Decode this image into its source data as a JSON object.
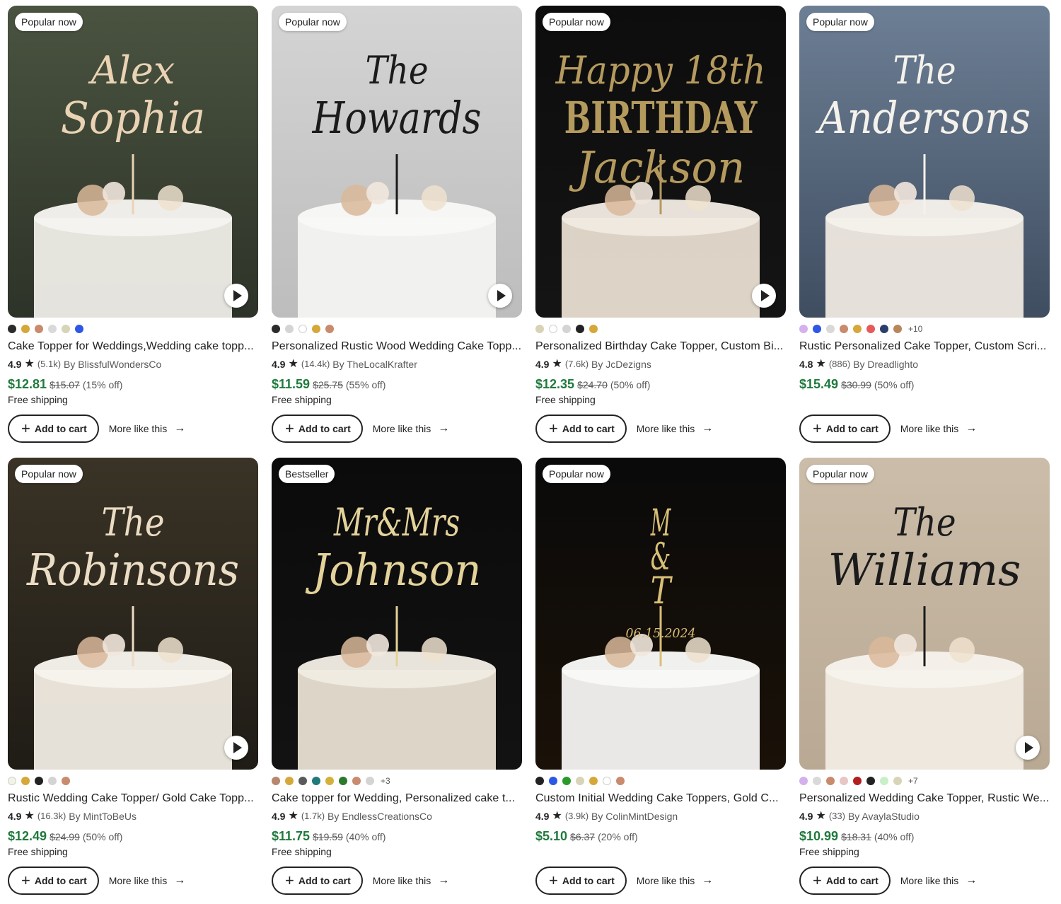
{
  "products": [
    {
      "badge": "Popular now",
      "has_video": true,
      "title": "Cake Topper for Weddings,Wedding cake topp...",
      "rating": "4.9",
      "reviews": "(5.1k)",
      "shop": "By BlissfulWondersCo",
      "price": "$12.81",
      "original_price": "$15.07",
      "discount": "(15% off)",
      "shipping": "Free shipping",
      "swatches": [
        "#2b2b2b",
        "#d6a83a",
        "#c98a6d",
        "#d9d9d9",
        "#d8d4b8",
        "#2e57e6"
      ],
      "more_swatches": "",
      "image": {
        "name": "cake-topper-alex-sophia-image",
        "bg": [
          "#4a5340",
          "#2d3328"
        ],
        "script": [
          "Alex",
          "Sophia"
        ],
        "script_color": "#e9d3b4",
        "cake": "#efede7"
      }
    },
    {
      "badge": "Popular now",
      "has_video": true,
      "title": "Personalized Rustic Wood Wedding Cake Topp...",
      "rating": "4.9",
      "reviews": "(14.4k)",
      "shop": "By TheLocalKrafter",
      "price": "$11.59",
      "original_price": "$25.75",
      "discount": "(55% off)",
      "shipping": "Free shipping",
      "swatches": [
        "#2b2b2b",
        "#d4d4d4",
        "#ffffff",
        "#d6a83a",
        "#c98a6d"
      ],
      "more_swatches": "",
      "image": {
        "name": "cake-topper-howards-image",
        "bg": [
          "#d4d4d4",
          "#bdbdbd"
        ],
        "script": [
          "The",
          "Howards"
        ],
        "script_color": "#1b1b1b",
        "cake": "#f3f3f1"
      }
    },
    {
      "badge": "Popular now",
      "has_video": true,
      "title": "Personalized Birthday Cake Topper, Custom Bi...",
      "rating": "4.9",
      "reviews": "(7.6k)",
      "shop": "By JcDezigns",
      "price": "$12.35",
      "original_price": "$24.70",
      "discount": "(50% off)",
      "shipping": "Free shipping",
      "swatches": [
        "#d8d2b6",
        "#ffffff",
        "#d4d4d4",
        "#222222",
        "#d6a83a"
      ],
      "more_swatches": "",
      "image": {
        "name": "cake-topper-happy-18th-birthday-image",
        "bg": [
          "#0d0d0d",
          "#141414"
        ],
        "script": [
          "Happy 18th",
          "BIRTHDAY",
          "Jackson"
        ],
        "script_color": "#b59a5e",
        "cake": "#e8ddd0"
      }
    },
    {
      "badge": "Popular now",
      "has_video": false,
      "title": "Rustic Personalized Cake Topper, Custom Scri...",
      "rating": "4.8",
      "reviews": "(886)",
      "shop": "By Dreadlighto",
      "price": "$15.49",
      "original_price": "$30.99",
      "discount": "(50% off)",
      "shipping": "",
      "swatches": [
        "#d4b0ec",
        "#2e57e6",
        "#d9d9d9",
        "#c98a6d",
        "#d6a83a",
        "#e55a5a",
        "#2b3e6b",
        "#b8865a"
      ],
      "more_swatches": "+10",
      "image": {
        "name": "cake-topper-andersons-image",
        "bg": [
          "#6d7f95",
          "#3f4d60"
        ],
        "script": [
          "The",
          "Andersons"
        ],
        "script_color": "#f5f2ec",
        "cake": "#eee8df"
      }
    },
    {
      "badge": "Popular now",
      "has_video": true,
      "title": "Rustic Wedding Cake Topper/ Gold Cake Topp...",
      "rating": "4.9",
      "reviews": "(16.3k)",
      "shop": "By MintToBeUs",
      "price": "$12.49",
      "original_price": "$24.99",
      "discount": "(50% off)",
      "shipping": "Free shipping",
      "swatches": [
        "#f2f2e6",
        "#d6a83a",
        "#222222",
        "#d4d4d4",
        "#c98a6d"
      ],
      "more_swatches": "",
      "image": {
        "name": "cake-topper-robinsons-image",
        "bg": [
          "#3a3326",
          "#1f1c16"
        ],
        "script": [
          "The",
          "Robinsons"
        ],
        "script_color": "#ebdcc4",
        "cake": "#f1ece3"
      }
    },
    {
      "badge": "Bestseller",
      "has_video": false,
      "title": "Cake topper for Wedding, Personalized cake t...",
      "rating": "4.9",
      "reviews": "(1.7k)",
      "shop": "By EndlessCreationsCo",
      "price": "$11.75",
      "original_price": "$19.59",
      "discount": "(40% off)",
      "shipping": "Free shipping",
      "swatches": [
        "#b8866d",
        "#d6a83a",
        "#5a5a5a",
        "#1f7a7a",
        "#d6b13a",
        "#2a7a2a",
        "#c98a6d",
        "#d4d4d4"
      ],
      "more_swatches": "+3",
      "image": {
        "name": "cake-topper-mr-mrs-johnson-image",
        "bg": [
          "#0b0b0b",
          "#121212"
        ],
        "script": [
          "Mr&Mrs",
          "Johnson"
        ],
        "script_color": "#e3d29a",
        "cake": "#e9e1d3"
      }
    },
    {
      "badge": "Popular now",
      "has_video": false,
      "title": "Custom Initial Wedding Cake Toppers, Gold C...",
      "rating": "4.9",
      "reviews": "(3.9k)",
      "shop": "By ColinMintDesign",
      "price": "$5.10",
      "original_price": "$6.37",
      "discount": "(20% off)",
      "shipping": "",
      "swatches": [
        "#222222",
        "#2e57e6",
        "#2a9a2a",
        "#d8d4b8",
        "#d6a83a",
        "#ffffff",
        "#c98a6d"
      ],
      "more_swatches": "",
      "image": {
        "name": "cake-topper-initials-wreath-image",
        "bg": [
          "#0a0a0a",
          "#1a1108"
        ],
        "script": [
          "M",
          "&",
          "T",
          "06.15.2024"
        ],
        "script_color": "#d8bf77",
        "cake": "#f4f4f2"
      }
    },
    {
      "badge": "Popular now",
      "has_video": true,
      "title": "Personalized Wedding Cake Topper, Rustic We...",
      "rating": "4.9",
      "reviews": "(33)",
      "shop": "By AvaylaStudio",
      "price": "$10.99",
      "original_price": "$18.31",
      "discount": "(40% off)",
      "shipping": "Free shipping",
      "swatches": [
        "#d4b0ec",
        "#d9d9d9",
        "#c98a6d",
        "#e8c6c6",
        "#b31f1f",
        "#222222",
        "#c8efc8",
        "#d8d4b8"
      ],
      "more_swatches": "+7",
      "image": {
        "name": "cake-topper-williams-image",
        "bg": [
          "#cbbda9",
          "#b9a994"
        ],
        "script": [
          "The",
          "Williams"
        ],
        "script_color": "#1b1b1b",
        "cake": "#f0ebe2"
      }
    }
  ],
  "labels": {
    "add_to_cart": "Add to cart",
    "more_like_this": "More like this"
  }
}
